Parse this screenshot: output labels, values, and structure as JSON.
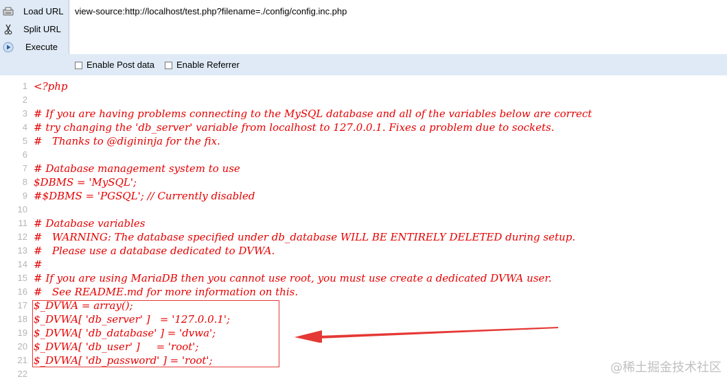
{
  "sidebar": {
    "items": [
      {
        "label": "Load URL",
        "icon": "load-url-icon"
      },
      {
        "label": "Split URL",
        "icon": "scissors-icon"
      },
      {
        "label": "Execute",
        "icon": "play-icon"
      }
    ]
  },
  "url_bar": {
    "value": "view-source:http://localhost/test.php?filename=./config/config.inc.php"
  },
  "options": {
    "post_data_label": "Enable Post data",
    "referrer_label": "Enable Referrer",
    "post_data_checked": false,
    "referrer_checked": false
  },
  "colors": {
    "code": "#e60000",
    "line_number": "#b5b5b5",
    "toolbar_bg": "#dfeaf6",
    "annotation": "#e53935"
  },
  "source_lines": [
    {
      "num": "1",
      "code": "<?php"
    },
    {
      "num": "2",
      "code": ""
    },
    {
      "num": "3",
      "code": "# If you are having problems connecting to the MySQL database and all of the variables below are correct"
    },
    {
      "num": "4",
      "code": "# try changing the 'db_server' variable from localhost to 127.0.0.1. Fixes a problem due to sockets."
    },
    {
      "num": "5",
      "code": "#   Thanks to @digininja for the fix."
    },
    {
      "num": "6",
      "code": ""
    },
    {
      "num": "7",
      "code": "# Database management system to use"
    },
    {
      "num": "8",
      "code": "$DBMS = 'MySQL';"
    },
    {
      "num": "9",
      "code": "#$DBMS = 'PGSQL'; // Currently disabled"
    },
    {
      "num": "10",
      "code": ""
    },
    {
      "num": "11",
      "code": "# Database variables"
    },
    {
      "num": "12",
      "code": "#   WARNING: The database specified under db_database WILL BE ENTIRELY DELETED during setup."
    },
    {
      "num": "13",
      "code": "#   Please use a database dedicated to DVWA."
    },
    {
      "num": "14",
      "code": "#"
    },
    {
      "num": "15",
      "code": "# If you are using MariaDB then you cannot use root, you must use create a dedicated DVWA user."
    },
    {
      "num": "16",
      "code": "#   See README.md for more information on this."
    },
    {
      "num": "17",
      "code": "$_DVWA = array();"
    },
    {
      "num": "18",
      "code": "$_DVWA[ 'db_server' ]   = '127.0.0.1';"
    },
    {
      "num": "19",
      "code": "$_DVWA[ 'db_database' ] = 'dvwa';"
    },
    {
      "num": "20",
      "code": "$_DVWA[ 'db_user' ]     = 'root';"
    },
    {
      "num": "21",
      "code": "$_DVWA[ 'db_password' ] = 'root';"
    },
    {
      "num": "22",
      "code": ""
    }
  ],
  "watermark": "@稀土掘金技术社区"
}
